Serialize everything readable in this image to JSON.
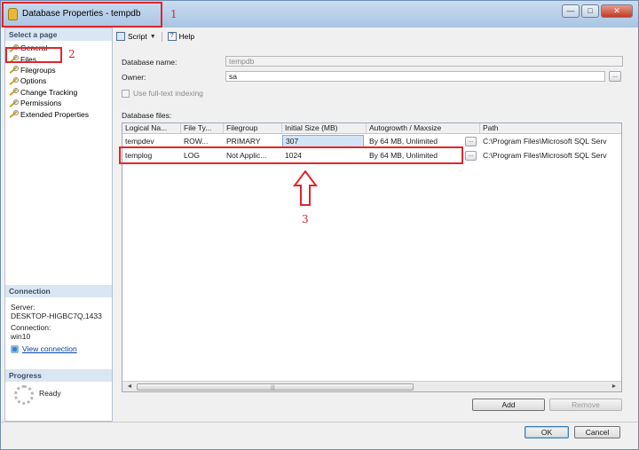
{
  "window": {
    "title": "Database Properties - tempdb",
    "minimize_glyph": "—",
    "maximize_glyph": "□",
    "close_glyph": "✕"
  },
  "sidebar": {
    "select_page_header": "Select a page",
    "pages": [
      {
        "label": "General"
      },
      {
        "label": "Files"
      },
      {
        "label": "Filegroups"
      },
      {
        "label": "Options"
      },
      {
        "label": "Change Tracking"
      },
      {
        "label": "Permissions"
      },
      {
        "label": "Extended Properties"
      }
    ],
    "connection_header": "Connection",
    "server_label": "Server:",
    "server_value": "DESKTOP-HIGBC7Q,1433",
    "connection_label": "Connection:",
    "connection_value": "win10",
    "view_connection_link": "View connection",
    "progress_header": "Progress",
    "progress_status": "Ready"
  },
  "toolbar": {
    "script_label": "Script",
    "help_label": "Help"
  },
  "form": {
    "database_name_label": "Database name:",
    "database_name_value": "tempdb",
    "owner_label": "Owner:",
    "owner_value": "sa",
    "fulltext_label": "Use full-text indexing",
    "database_files_label": "Database files:"
  },
  "files_grid": {
    "columns": [
      "Logical Na...",
      "File Ty...",
      "Filegroup",
      "Initial Size (MB)",
      "Autogrowth / Maxsize",
      "Path"
    ],
    "rows": [
      {
        "logical_name": "tempdev",
        "file_type": "ROW...",
        "filegroup": "PRIMARY",
        "initial_size": "307",
        "autogrowth": "By 64 MB, Unlimited",
        "path": "C:\\Program Files\\Microsoft SQL Serv"
      },
      {
        "logical_name": "templog",
        "file_type": "LOG",
        "filegroup": "Not Applic...",
        "initial_size": "1024",
        "autogrowth": "By 64 MB, Unlimited",
        "path": "C:\\Program Files\\Microsoft SQL Serv"
      }
    ],
    "ellipsis": "...",
    "scroll_left": "◄",
    "scroll_right": "►",
    "scroll_grip": "|||"
  },
  "buttons": {
    "add": "Add",
    "remove": "Remove",
    "ok": "OK",
    "cancel": "Cancel"
  },
  "annotations": {
    "marker_1": "1",
    "marker_2": "2",
    "marker_3": "3",
    "accent_color": "#e0262b"
  }
}
